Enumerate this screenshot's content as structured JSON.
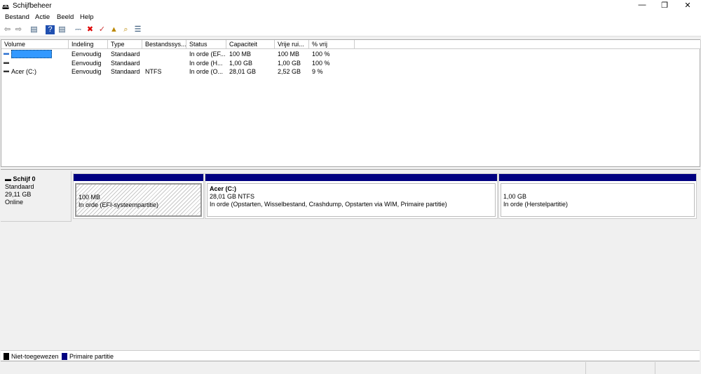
{
  "window": {
    "title": "Schijfbeheer",
    "minimize": "—",
    "restore": "❐",
    "close": "✕"
  },
  "menu": [
    "Bestand",
    "Actie",
    "Beeld",
    "Help"
  ],
  "toolbar": [
    {
      "icon": "back-arrow-icon",
      "glyph": "⇦"
    },
    {
      "icon": "forward-arrow-icon",
      "glyph": "⇨"
    },
    {
      "icon": "console-tree-icon",
      "glyph": "▤"
    },
    {
      "icon": "help-icon",
      "glyph": "?"
    },
    {
      "icon": "properties-icon",
      "glyph": "▤"
    },
    {
      "icon": "connect-drive-icon",
      "glyph": "⎓"
    },
    {
      "icon": "delete-icon",
      "glyph": "✖"
    },
    {
      "icon": "check-icon",
      "glyph": "✓"
    },
    {
      "icon": "folder-up-icon",
      "glyph": "▲"
    },
    {
      "icon": "folder-search-icon",
      "glyph": "⌕"
    },
    {
      "icon": "list-view-icon",
      "glyph": "☰"
    }
  ],
  "columns": [
    "Volume",
    "Indeling",
    "Type",
    "Bestandssys...",
    "Status",
    "Capaciteit",
    "Vrije rui...",
    "% vrij"
  ],
  "rows": [
    [
      "",
      "Eenvoudig",
      "Standaard",
      "",
      "In orde (EF...",
      "100 MB",
      "100 MB",
      "100 %"
    ],
    [
      "",
      "Eenvoudig",
      "Standaard",
      "",
      "In orde (H...",
      "1,00 GB",
      "1,00 GB",
      "100 %"
    ],
    [
      "Acer (C:)",
      "Eenvoudig",
      "Standaard",
      "NTFS",
      "In orde (O...",
      "28,01 GB",
      "2,52 GB",
      "9 %"
    ]
  ],
  "disk": {
    "name": "Schijf 0",
    "type": "Standaard",
    "size": "29,11 GB",
    "state": "Online"
  },
  "partitions": [
    {
      "name": "",
      "size": "100 MB",
      "status": "In orde (EFI-systeempartitie)"
    },
    {
      "name": "Acer  (C:)",
      "size": "28,01 GB NTFS",
      "status": "In orde (Opstarten, Wisselbestand, Crashdump, Opstarten via WIM, Primaire partitie)"
    },
    {
      "name": "",
      "size": "1,00 GB",
      "status": "In orde (Herstelpartitie)"
    }
  ],
  "legend": [
    {
      "label": "Niet-toegewezen",
      "color": "#000000"
    },
    {
      "label": "Primaire partitie",
      "color": "#000080"
    }
  ],
  "colors": {
    "partition_bar": "#000080",
    "selection": "#3399ff"
  }
}
